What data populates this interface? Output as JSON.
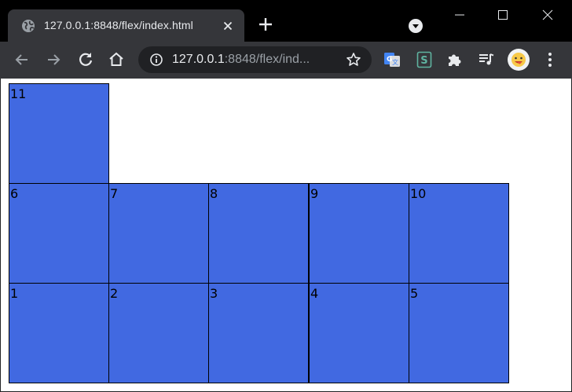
{
  "browser": {
    "tab_title": "127.0.0.1:8848/flex/index.html",
    "url_host": "127.0.0.1",
    "url_rest": ":8848/flex/ind...",
    "accent_color": "#4169e1"
  },
  "icons": {
    "tab_favicon": "globe-icon",
    "tab_close": "close-icon",
    "new_tab": "plus-icon",
    "tab_search": "tab-search-icon",
    "back": "back-arrow-icon",
    "forward": "forward-arrow-icon",
    "reload": "reload-icon",
    "home": "home-icon",
    "site_info": "info-icon",
    "bookmark": "star-icon",
    "translate": "google-translate-icon",
    "extension_s": "s-extension-icon",
    "extensions": "puzzle-icon",
    "media": "playlist-icon",
    "profile": "avatar",
    "menu": "kebab-menu-icon"
  },
  "page": {
    "boxes": [
      "1",
      "2",
      "3",
      "4",
      "5",
      "6",
      "7",
      "8",
      "9",
      "10",
      "11"
    ],
    "box_color": "#4169e1",
    "border_color": "#000000"
  }
}
